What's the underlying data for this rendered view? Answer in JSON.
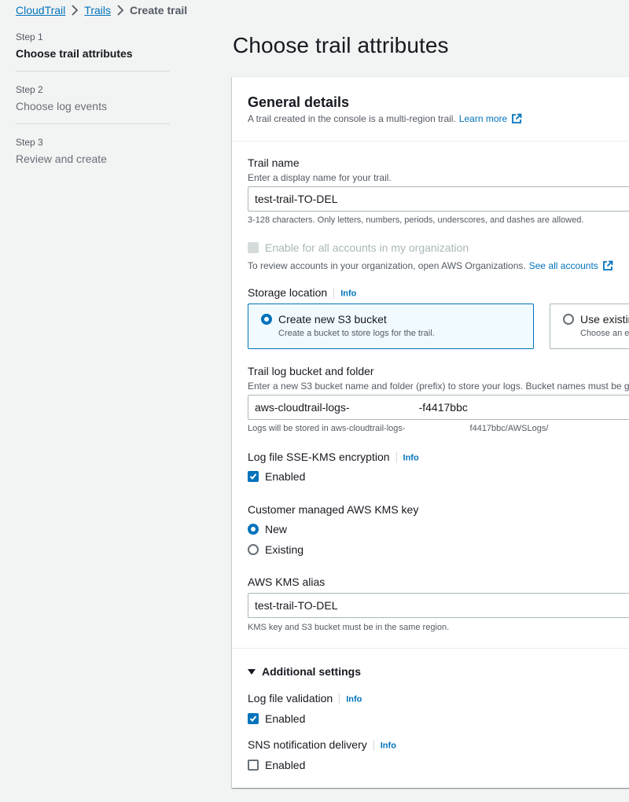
{
  "breadcrumb": {
    "items": [
      "CloudTrail",
      "Trails"
    ],
    "current": "Create trail"
  },
  "steps": [
    {
      "number": "Step 1",
      "title": "Choose trail attributes",
      "active": true
    },
    {
      "number": "Step 2",
      "title": "Choose log events",
      "active": false
    },
    {
      "number": "Step 3",
      "title": "Review and create",
      "active": false
    }
  ],
  "page": {
    "title": "Choose trail attributes"
  },
  "general": {
    "title": "General details",
    "description": "A trail created in the console is a multi-region trail.",
    "learn_more": "Learn more"
  },
  "trail_name": {
    "label": "Trail name",
    "description": "Enter a display name for your trail.",
    "value": "test-trail-TO-DEL",
    "constraint": "3-128 characters. Only letters, numbers, periods, underscores, and dashes are allowed."
  },
  "organization": {
    "checkbox_label": "Enable for all accounts in my organization",
    "checked": false,
    "disabled": true,
    "description": "To review accounts in your organization, open AWS Organizations.",
    "link": "See all accounts"
  },
  "storage": {
    "label": "Storage location",
    "info": "Info",
    "options": [
      {
        "label": "Create new S3 bucket",
        "description": "Create a bucket to store logs for the trail.",
        "selected": true
      },
      {
        "label": "Use existin",
        "description": "Choose an e",
        "selected": false
      }
    ]
  },
  "bucket": {
    "label": "Trail log bucket and folder",
    "description": "Enter a new S3 bucket name and folder (prefix) to store your logs. Bucket names must be g",
    "value_prefix": "aws-cloudtrail-logs-",
    "value_suffix": "-f4417bbc",
    "constraint_prefix": "Logs will be stored in aws-cloudtrail-logs-",
    "constraint_suffix": "f4417bbc/AWSLogs/"
  },
  "sse": {
    "label": "Log file SSE-KMS encryption",
    "info": "Info",
    "checkbox_label": "Enabled",
    "checked": true
  },
  "kms_key": {
    "label": "Customer managed AWS KMS key",
    "options": [
      {
        "label": "New",
        "selected": true
      },
      {
        "label": "Existing",
        "selected": false
      }
    ]
  },
  "kms_alias": {
    "label": "AWS KMS alias",
    "value": "test-trail-TO-DEL",
    "constraint": "KMS key and S3 bucket must be in the same region."
  },
  "additional": {
    "title": "Additional settings",
    "validation": {
      "label": "Log file validation",
      "info": "Info",
      "checkbox_label": "Enabled",
      "checked": true
    },
    "sns": {
      "label": "SNS notification delivery",
      "info": "Info",
      "checkbox_label": "Enabled",
      "checked": false
    }
  },
  "colors": {
    "link": "#0073bb",
    "background": "#f2f3f3",
    "panel": "#ffffff",
    "text": "#16191f",
    "muted": "#545b64",
    "selected_tile": "#f1faff"
  }
}
